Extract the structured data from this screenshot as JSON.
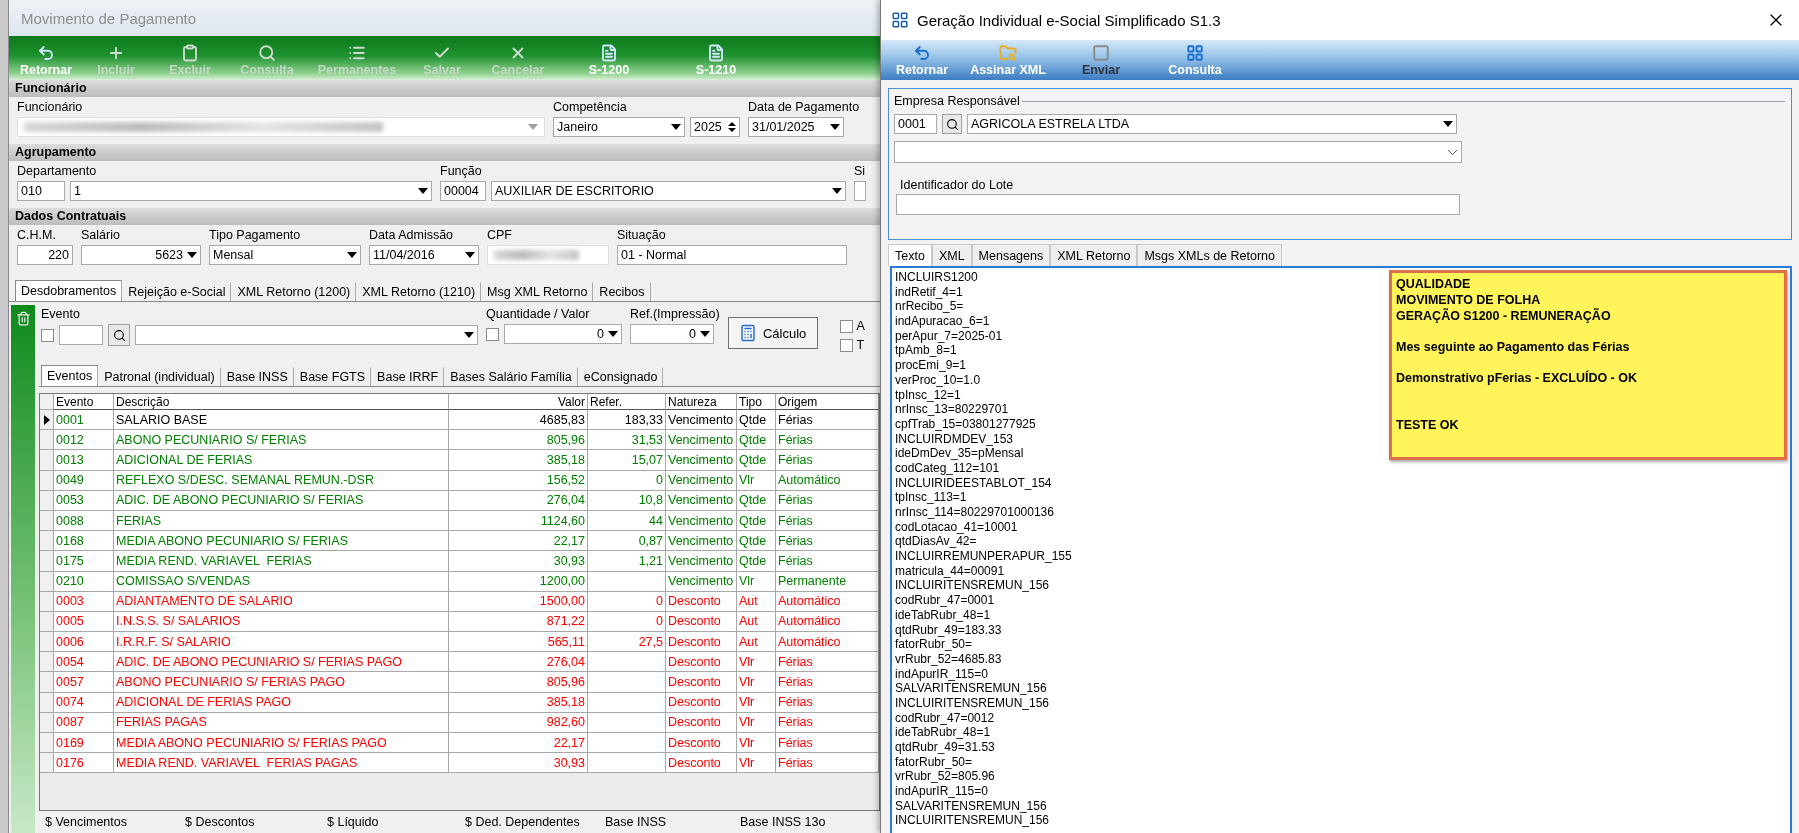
{
  "main_window": {
    "title": "Movimento de Pagamento",
    "toolbar": [
      {
        "label": "Retornar",
        "kind": "undo",
        "disabled": false
      },
      {
        "label": "Incluir",
        "kind": "plus",
        "disabled": true
      },
      {
        "label": "Excluir",
        "kind": "clipboard",
        "disabled": true
      },
      {
        "label": "Consulta",
        "kind": "search",
        "disabled": true
      },
      {
        "label": "Permanentes",
        "kind": "list",
        "disabled": true
      },
      {
        "label": "Salvar",
        "kind": "check",
        "disabled": true
      },
      {
        "label": "Cancelar",
        "kind": "cancel",
        "disabled": true
      },
      {
        "label": "S-1200",
        "kind": "file",
        "disabled": false
      },
      {
        "label": "S-1210",
        "kind": "file",
        "disabled": false
      }
    ],
    "sections": [
      {
        "header": "Funcionário",
        "groups": [
          {
            "label": "Funcionário",
            "inputs": [
              {
                "kind": "blurred-combo"
              }
            ]
          },
          {
            "label": "Competência",
            "inputs": [
              {
                "kind": "combo",
                "value": "Janeiro"
              },
              {
                "kind": "spin",
                "value": "2025"
              }
            ]
          },
          {
            "label": "Data de Pagamento",
            "inputs": [
              {
                "kind": "combo",
                "value": "31/01/2025"
              }
            ]
          }
        ]
      },
      {
        "header": "Agrupamento",
        "groups": [
          {
            "label": "Departamento",
            "inputs": [
              {
                "kind": "text",
                "value": "010"
              },
              {
                "kind": "combo",
                "value": "1"
              }
            ]
          },
          {
            "label": "Função",
            "inputs": [
              {
                "kind": "text",
                "value": "00004"
              },
              {
                "kind": "combo",
                "value": "AUXILIAR DE ESCRITORIO"
              }
            ]
          },
          {
            "label": "Si",
            "inputs": [
              {
                "kind": "text"
              }
            ]
          }
        ]
      },
      {
        "header": "Dados Contratuais",
        "groups": [
          {
            "label": "C.H.M.",
            "inputs": [
              {
                "kind": "number",
                "value": "220"
              }
            ]
          },
          {
            "label": "Salário",
            "inputs": [
              {
                "kind": "number-combo",
                "value": "5623"
              }
            ]
          },
          {
            "label": "Tipo Pagamento",
            "inputs": [
              {
                "kind": "combo",
                "value": "Mensal"
              }
            ]
          },
          {
            "label": "Data Admissão",
            "inputs": [
              {
                "kind": "combo",
                "value": "11/04/2016"
              }
            ]
          },
          {
            "label": "CPF",
            "inputs": [
              {
                "kind": "blurred"
              }
            ]
          },
          {
            "label": "Situação",
            "inputs": [
              {
                "kind": "text",
                "value": "01 - Normal"
              }
            ]
          }
        ]
      }
    ],
    "tabs": [
      {
        "label": "Desdobramentos",
        "selected": true
      },
      {
        "label": "Rejeição e-Social",
        "selected": false
      },
      {
        "label": "XML Retorno (1200)",
        "selected": false
      },
      {
        "label": "XML Retorno (1210)",
        "selected": false
      },
      {
        "label": "Msg XML Retorno",
        "selected": false
      },
      {
        "label": "Recibos",
        "selected": false
      }
    ],
    "evento_panel": {
      "groups": [
        {
          "label": "Evento",
          "inputs": [
            {
              "kind": "checkbox",
              "checked": false
            },
            {
              "kind": "text"
            },
            {
              "kind": "search-button"
            },
            {
              "kind": "combo"
            }
          ]
        },
        {
          "label": "Quantidade / Valor",
          "inputs": [
            {
              "kind": "checkbox",
              "checked": false
            },
            {
              "kind": "number-combo",
              "value": "0"
            }
          ]
        },
        {
          "label": "Ref.(Impressão)",
          "inputs": [
            {
              "kind": "number-combo",
              "value": "0"
            }
          ]
        }
      ],
      "button": "Cálculo",
      "options": [
        {
          "label": "A",
          "checked": false
        },
        {
          "label": "T",
          "checked": false
        }
      ]
    },
    "sub_tabs": [
      {
        "label": "Eventos",
        "selected": true
      },
      {
        "label": "Patronal (individual)",
        "selected": false
      },
      {
        "label": "Base INSS",
        "selected": false
      },
      {
        "label": "Base FGTS",
        "selected": false
      },
      {
        "label": "Base IRRF",
        "selected": false
      },
      {
        "label": "Bases Salário Família",
        "selected": false
      },
      {
        "label": "eConsignado",
        "selected": false
      }
    ],
    "table": {
      "columns": [
        "Evento",
        "Descrição",
        "Valor",
        "Refer.",
        "Natureza",
        "Tipo",
        "Origem"
      ],
      "rows": [
        {
          "evento": "0001",
          "descricao": "SALARIO BASE",
          "valor": "4685,83",
          "refer": "183,33",
          "natureza": "Vencimento",
          "tipo": "Qtde",
          "origem": "Férias",
          "color": "#008000",
          "selected": true
        },
        {
          "evento": "0012",
          "descricao": "ABONO PECUNIARIO S/ FERIAS",
          "valor": "805,96",
          "refer": "31,53",
          "natureza": "Vencimento",
          "tipo": "Qtde",
          "origem": "Férias",
          "color": "#008000",
          "selected": false
        },
        {
          "evento": "0013",
          "descricao": "ADICIONAL DE FERIAS",
          "valor": "385,18",
          "refer": "15,07",
          "natureza": "Vencimento",
          "tipo": "Qtde",
          "origem": "Férias",
          "color": "#008000",
          "selected": false
        },
        {
          "evento": "0049",
          "descricao": "REFLEXO S/DESC. SEMANAL REMUN.-DSR",
          "valor": "156,52",
          "refer": "0",
          "natureza": "Vencimento",
          "tipo": "Vlr",
          "origem": "Automático",
          "color": "#008000",
          "selected": false
        },
        {
          "evento": "0053",
          "descricao": "ADIC. DE ABONO PECUNIARIO S/ FERIAS",
          "valor": "276,04",
          "refer": "10,8",
          "natureza": "Vencimento",
          "tipo": "Qtde",
          "origem": "Férias",
          "color": "#008000",
          "selected": false
        },
        {
          "evento": "0088",
          "descricao": "FERIAS",
          "valor": "1124,60",
          "refer": "44",
          "natureza": "Vencimento",
          "tipo": "Qtde",
          "origem": "Férias",
          "color": "#008000",
          "selected": false
        },
        {
          "evento": "0168",
          "descricao": "MEDIA ABONO PECUNIARIO S/ FERIAS",
          "valor": "22,17",
          "refer": "0,87",
          "natureza": "Vencimento",
          "tipo": "Qtde",
          "origem": "Férias",
          "color": "#008000",
          "selected": false
        },
        {
          "evento": "0175",
          "descricao": "MEDIA REND. VARIAVEL  FERIAS",
          "valor": "30,93",
          "refer": "1,21",
          "natureza": "Vencimento",
          "tipo": "Qtde",
          "origem": "Férias",
          "color": "#008000",
          "selected": false
        },
        {
          "evento": "0210",
          "descricao": "COMISSAO S/VENDAS",
          "valor": "1200,00",
          "natureza": "Vencimento",
          "tipo": "Vlr",
          "origem": "Permanente",
          "color": "#008000",
          "selected": false
        },
        {
          "evento": "0003",
          "descricao": "ADIANTAMENTO DE SALARIO",
          "valor": "1500,00",
          "refer": "0",
          "natureza": "Desconto",
          "tipo": "Aut",
          "origem": "Automático",
          "color": "#ff0000",
          "selected": false
        },
        {
          "evento": "0005",
          "descricao": "I.N.S.S. S/ SALARIOS",
          "valor": "871,22",
          "refer": "0",
          "natureza": "Desconto",
          "tipo": "Aut",
          "origem": "Automático",
          "color": "#ff0000",
          "selected": false
        },
        {
          "evento": "0006",
          "descricao": "I.R.R.F. S/ SALARIO",
          "valor": "565,11",
          "refer": "27,5",
          "natureza": "Desconto",
          "tipo": "Aut",
          "origem": "Automático",
          "color": "#ff0000",
          "selected": false
        },
        {
          "evento": "0054",
          "descricao": "ADIC. DE ABONO PECUNIARIO S/ FERIAS PAGO",
          "valor": "276,04",
          "natureza": "Desconto",
          "tipo": "Vlr",
          "origem": "Férias",
          "color": "#ff0000",
          "selected": false
        },
        {
          "evento": "0057",
          "descricao": "ABONO PECUNIARIO S/ FERIAS PAGO",
          "valor": "805,96",
          "natureza": "Desconto",
          "tipo": "Vlr",
          "origem": "Férias",
          "color": "#ff0000",
          "selected": false
        },
        {
          "evento": "0074",
          "descricao": "ADICIONAL DE FERIAS PAGO",
          "valor": "385,18",
          "natureza": "Desconto",
          "tipo": "Vlr",
          "origem": "Férias",
          "color": "#ff0000",
          "selected": false
        },
        {
          "evento": "0087",
          "descricao": "FERIAS PAGAS",
          "valor": "982,60",
          "natureza": "Desconto",
          "tipo": "Vlr",
          "origem": "Férias",
          "color": "#ff0000",
          "selected": false
        },
        {
          "evento": "0169",
          "descricao": "MEDIA ABONO PECUNIARIO S/ FERIAS PAGO",
          "valor": "22,17",
          "natureza": "Desconto",
          "tipo": "Vlr",
          "origem": "Férias",
          "color": "#ff0000",
          "selected": false
        },
        {
          "evento": "0176",
          "descricao": "MEDIA REND. VARIAVEL  FERIAS PAGAS",
          "valor": "30,93",
          "natureza": "Desconto",
          "tipo": "Vlr",
          "origem": "Férias",
          "color": "#ff0000",
          "selected": false
        }
      ]
    },
    "totals": [
      "$ Vencimentos",
      "$ Descontos",
      "$ Líquido",
      "$ Ded. Dependentes",
      "Base INSS",
      "Base INSS 13o"
    ]
  },
  "dialog": {
    "title": "Geração Individual e-Social Simplificado S1.3",
    "toolbar": [
      {
        "label": "Retornar",
        "kind": "undo",
        "disabled": false
      },
      {
        "label": "Assinar XML",
        "kind": "folder",
        "disabled": false
      },
      {
        "label": "Enviar",
        "kind": "stop",
        "disabled": true
      },
      {
        "label": "Consulta",
        "kind": "grid",
        "disabled": false
      }
    ],
    "empresa": {
      "legend": "Empresa Responsável",
      "code": "0001",
      "name": "AGRICOLA ESTRELA LTDA"
    },
    "lote_label": "Identificador do Lote",
    "tabs": [
      {
        "label": "Texto",
        "selected": true
      },
      {
        "label": "XML",
        "selected": false
      },
      {
        "label": "Mensagens",
        "selected": false
      },
      {
        "label": "XML Retorno",
        "selected": false
      },
      {
        "label": "Msgs XMLs de Retorno",
        "selected": false
      }
    ],
    "text_lines": [
      "INCLUIRS1200",
      "indRetif_4=1",
      "nrRecibo_5=",
      "indApuracao_6=1",
      "perApur_7=2025-01",
      "tpAmb_8=1",
      "procEmi_9=1",
      "verProc_10=1.0",
      "tpInsc_12=1",
      "nrInsc_13=80229701",
      "cpfTrab_15=03801277925",
      "INCLUIRDMDEV_153",
      "ideDmDev_35=pMensal",
      "codCateg_112=101",
      "INCLUIRIDEESTABLOT_154",
      "tpInsc_113=1",
      "nrInsc_114=80229701000136",
      "codLotacao_41=10001",
      "qtdDiasAv_42=",
      "INCLUIRREMUNPERAPUR_155",
      "matricula_44=00091",
      "INCLUIRITENSREMUN_156",
      "codRubr_47=0001",
      "ideTabRubr_48=1",
      "qtdRubr_49=183.33",
      "fatorRubr_50=",
      "vrRubr_52=4685.83",
      "indApurIR_115=0",
      "SALVARITENSREMUN_156",
      "INCLUIRITENSREMUN_156",
      "codRubr_47=0012",
      "ideTabRubr_48=1",
      "qtdRubr_49=31.53",
      "fatorRubr_50=",
      "vrRubr_52=805.96",
      "indApurIR_115=0",
      "SALVARITENSREMUN_156",
      "INCLUIRITENSREMUN_156"
    ],
    "note": [
      [
        "QUALIDADE",
        "MOVIMENTO DE FOLHA",
        "GERAÇÃO S1200 - REMUNERAÇÃO"
      ],
      [
        "Mes seguinte ao Pagamento das Férias"
      ],
      [
        "Demonstrativo pFerias - EXCLUÍDO - OK"
      ],
      [
        "TESTE OK"
      ]
    ]
  }
}
